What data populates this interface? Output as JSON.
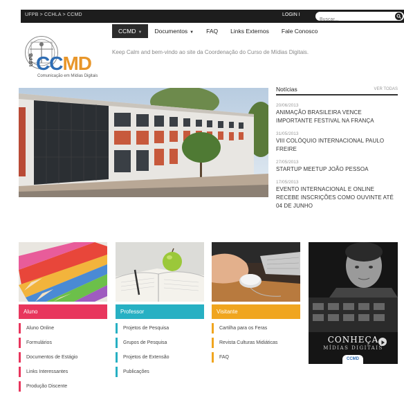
{
  "topbar": {
    "breadcrumb": "UFPB > CCHLA > CCMD",
    "login": "LOGIN I",
    "search_placeholder": "Buscar..."
  },
  "nav": {
    "items": [
      {
        "label": "CCMD",
        "has_dropdown": true,
        "active": true
      },
      {
        "label": "Documentos",
        "has_dropdown": true
      },
      {
        "label": "FAQ"
      },
      {
        "label": "Links Externos"
      },
      {
        "label": "Fale Conosco"
      }
    ]
  },
  "logo": {
    "badge": "UFPB",
    "text_part1": "CC",
    "text_part2": "MD",
    "subtitle": "Comunicação em Mídias Digitais"
  },
  "tagline": "Keep Calm and bem-vindo ao site da Coordenação do Curso de Mídias Digitais.",
  "news": {
    "title": "Notícias",
    "see_all": "VER TODAS",
    "items": [
      {
        "date": "20/06/2013",
        "text": "ANIMAÇÃO BRASILEIRA VENCE IMPORTANTE FESTIVAL NA FRANÇA"
      },
      {
        "date": "31/05/2013",
        "text": "VIII COLÓQUIO INTERNACIONAL PAULO FREIRE"
      },
      {
        "date": "27/05/2013",
        "text": "STARTUP MEETUP JOÃO PESSOA"
      },
      {
        "date": "17/05/2013",
        "text": "EVENTO INTERNACIONAL E ONLINE RECEBE INSCRIÇÕES COMO OUVINTE ATÉ 04 DE JUNHO"
      }
    ]
  },
  "columns": {
    "aluno": {
      "title": "Aluno",
      "color": "#e8365d",
      "items": [
        "Aluno Online",
        "Formulários",
        "Documentos de Estágio",
        "Links Interessantes",
        "Produção Discente"
      ]
    },
    "professor": {
      "title": "Professor",
      "color": "#27b0c3",
      "items": [
        "Projetos de Pesquisa",
        "Grupos de Pesquisa",
        "Projetos de Extensão",
        "Publicações"
      ]
    },
    "visitante": {
      "title": "Visitante",
      "color": "#f0a51f",
      "items": [
        "Cartilha para os Feras",
        "Revista Culturas Midiáticas",
        "FAQ"
      ]
    }
  },
  "promo": {
    "title": "CONHEÇA",
    "subtitle": "MÍDIAS DIGITAIS",
    "badge": "CCMD"
  }
}
